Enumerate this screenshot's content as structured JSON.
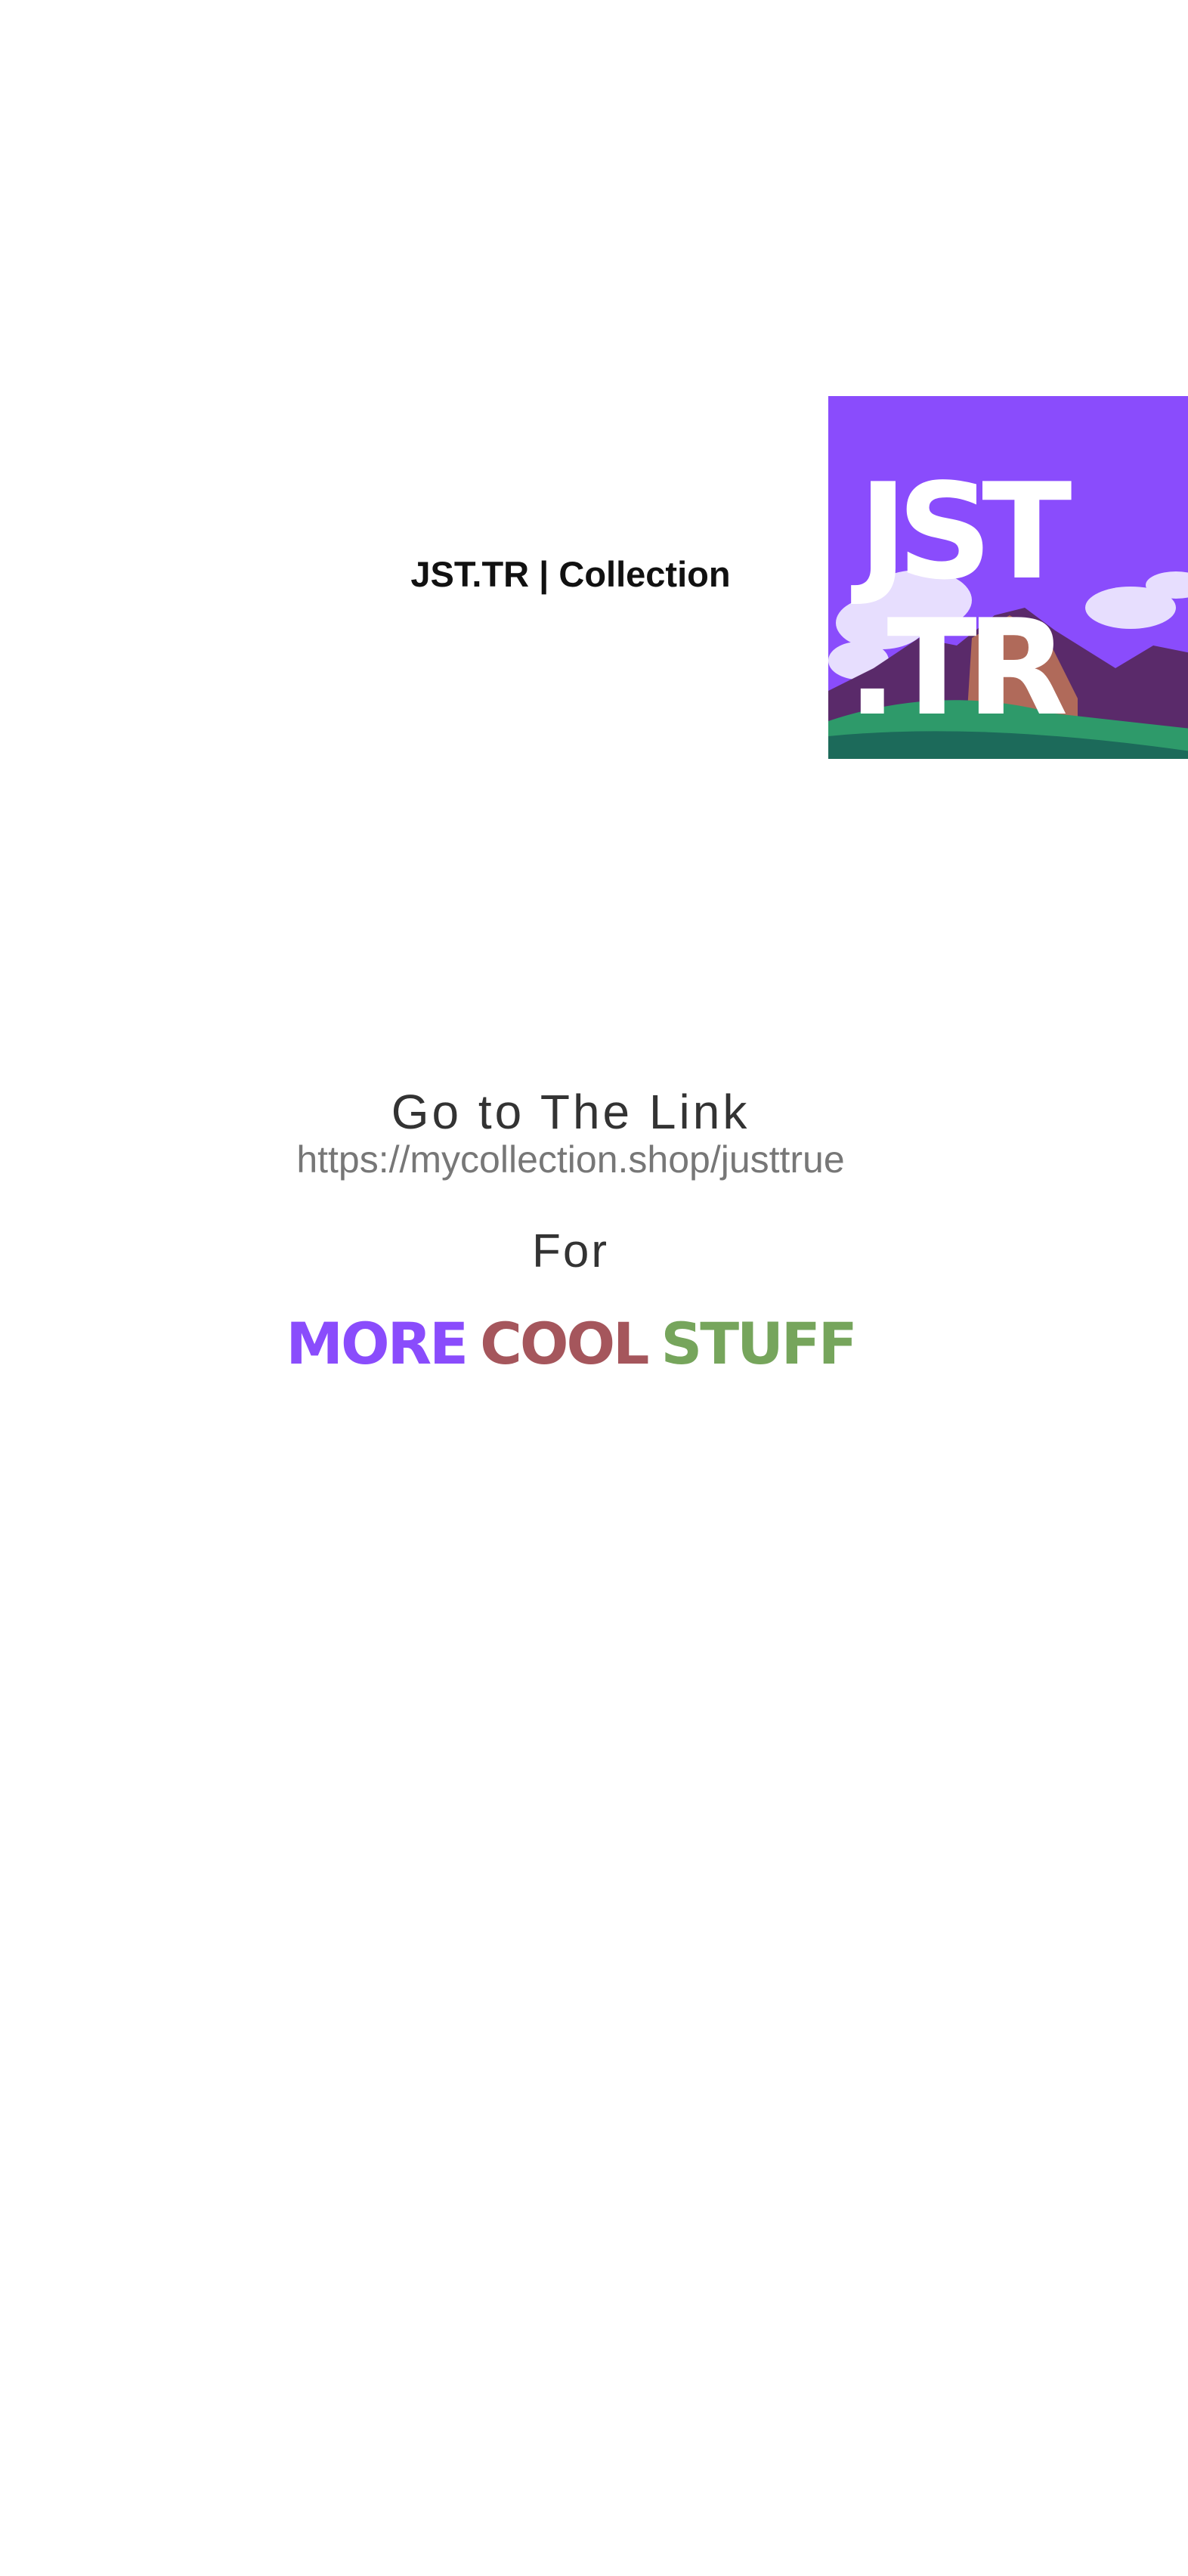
{
  "header": {
    "title": "JST.TR | Collection",
    "logo": {
      "line1": "JST",
      "line2": ".TR",
      "background": "#8a4cfc"
    }
  },
  "main": {
    "heading": "Go to The Link",
    "link": "https://mycollection.shop/justtrue",
    "for_label": "For",
    "cta_words": [
      {
        "text": "MORE",
        "color": "#8a4cfc"
      },
      {
        "text": "COOL",
        "color": "#a5565c"
      },
      {
        "text": "STUFF",
        "color": "#76a55c"
      }
    ]
  }
}
